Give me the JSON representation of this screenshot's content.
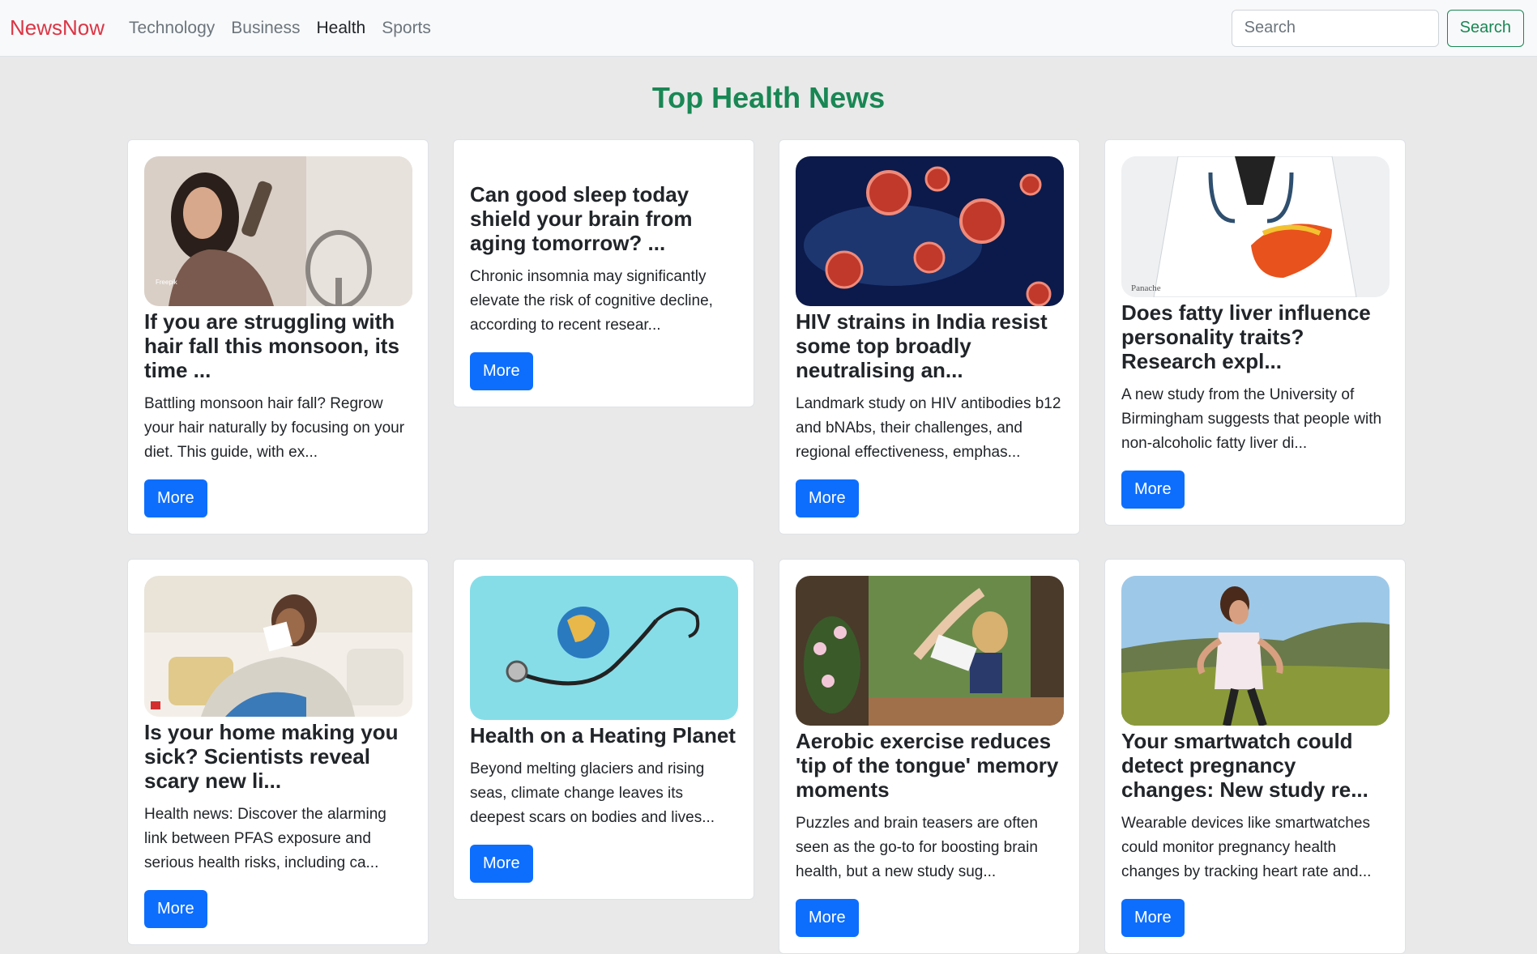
{
  "navbar": {
    "brand": "NewsNow",
    "links": [
      "Technology",
      "Business",
      "Health",
      "Sports"
    ],
    "active": "Health",
    "search_placeholder": "Search",
    "search_button": "Search"
  },
  "page_title": "Top Health News",
  "articles": [
    {
      "title": "If you are struggling with hair fall this monsoon, its time ...",
      "text": "Battling monsoon hair fall? Regrow your hair naturally by focusing on your diet. This guide, with ex...",
      "button": "More",
      "image": "woman-brushing-hair",
      "image_label": "Freepik"
    },
    {
      "title": "Can good sleep today shield your brain from aging tomorrow? ...",
      "text": "Chronic insomnia may significantly elevate the risk of cognitive decline, according to recent resear...",
      "button": "More",
      "image": null
    },
    {
      "title": "HIV strains in India resist some top broadly neutralising an...",
      "text": "Landmark study on HIV antibodies b12 and bNAbs, their challenges, and regional effectiveness, emphas...",
      "button": "More",
      "image": "virus-particles"
    },
    {
      "title": "Does fatty liver influence personality traits? Research expl...",
      "text": "A new study from the University of Birmingham suggests that people with non-alcoholic fatty liver di...",
      "button": "More",
      "image": "doctor-holding-liver",
      "image_label": "Panache"
    },
    {
      "title": "Is your home making you sick? Scientists reveal scary new li...",
      "text": "Health news: Discover the alarming link between PFAS exposure and serious health risks, including ca...",
      "button": "More",
      "image": "woman-sneezing"
    },
    {
      "title": "Health on a Heating Planet",
      "text": "Beyond melting glaciers and rising seas, climate change leaves its deepest scars on bodies and lives...",
      "button": "More",
      "image": "globe-stethoscope"
    },
    {
      "title": "Aerobic exercise reduces 'tip of the tongue' memory moments",
      "text": "Puzzles and brain teasers are often seen as the go-to for boosting brain health, but a new study sug...",
      "button": "More",
      "image": "woman-reading-window"
    },
    {
      "title": "Your smartwatch could detect pregnancy changes: New study re...",
      "text": "Wearable devices like smartwatches could monitor pregnancy health changes by tracking heart rate and...",
      "button": "More",
      "image": "woman-running"
    }
  ]
}
